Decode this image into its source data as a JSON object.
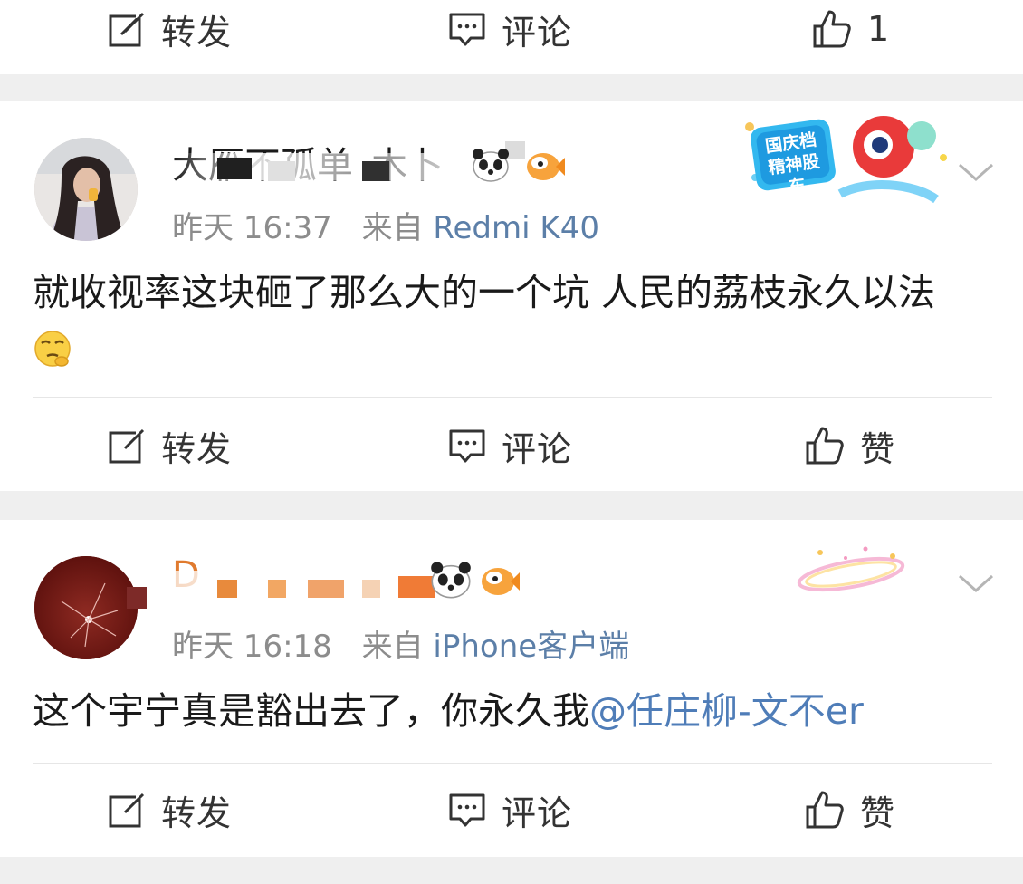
{
  "top_action_bar": {
    "repost_label": "转发",
    "comment_label": "评论",
    "like_label": "1"
  },
  "comments": [
    {
      "username_visible": "大雁不孤单_木卜",
      "time": "昨天 16:37",
      "source_prefix": "来自",
      "source_name": "Redmi K40",
      "badge": "国庆档精神股东",
      "text": "就收视率这块砸了那么大的一个坑 人民的荔枝永久以法",
      "emoji": "thinking-face-emoji",
      "actions": {
        "repost_label": "转发",
        "comment_label": "评论",
        "like_label": "赞"
      }
    },
    {
      "username_visible": "D",
      "time": "昨天 16:18",
      "source_prefix": "来自",
      "source_name": "iPhone客户端",
      "text_prefix": "这个宇宁真是豁出去了，你永久我",
      "mention": "@任庄柳-文不er",
      "actions": {
        "repost_label": "转发",
        "comment_label": "评论",
        "like_label": "赞"
      }
    }
  ],
  "colors": {
    "background": "#efefef",
    "card": "#ffffff",
    "meta_text": "#8c8c8c",
    "source_link": "#5c7fa8",
    "mention": "#4f7db8"
  }
}
